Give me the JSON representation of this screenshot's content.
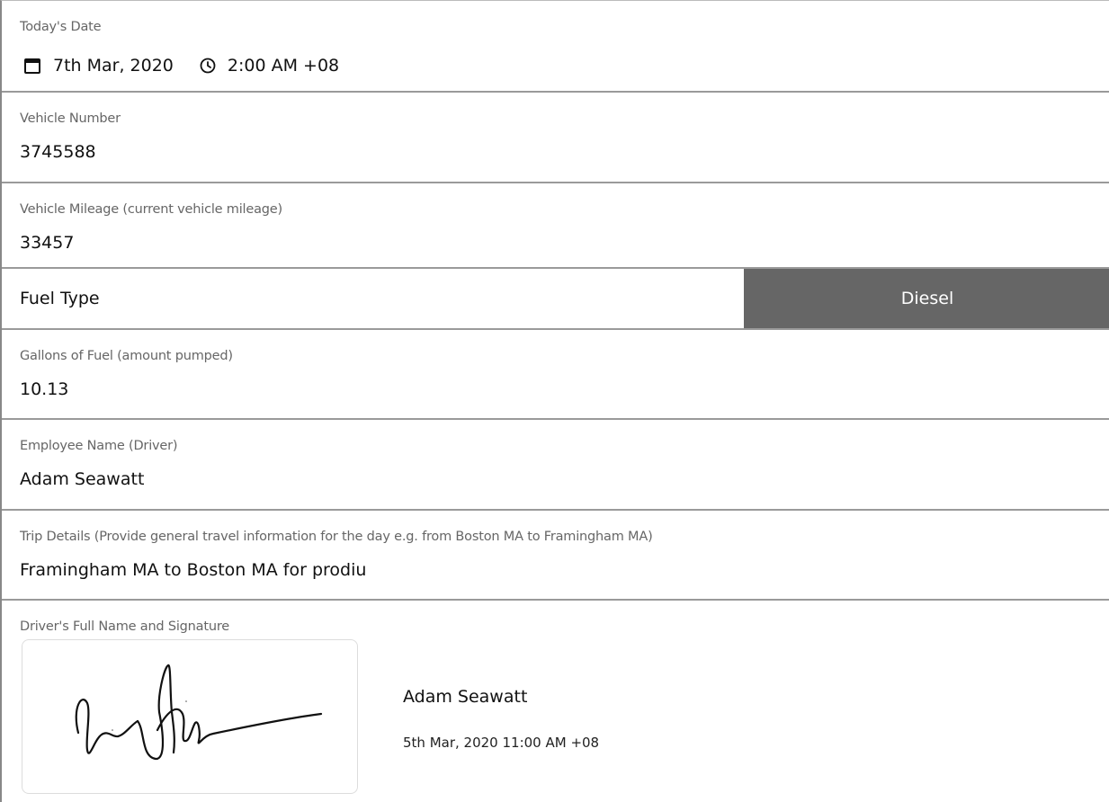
{
  "fields": {
    "date": {
      "label": "Today's Date",
      "date_value": "7th Mar, 2020",
      "time_value": "2:00 AM +08",
      "date_icon": "calendar-icon",
      "time_icon": "clock-icon"
    },
    "vehicle_number": {
      "label": "Vehicle Number",
      "value": "3745588"
    },
    "vehicle_mileage": {
      "label": "Vehicle Mileage (current vehicle mileage)",
      "value": "33457"
    },
    "fuel_type": {
      "label": "Fuel Type",
      "value": "Diesel"
    },
    "gallons": {
      "label": "Gallons of Fuel (amount pumped)",
      "value": "10.13"
    },
    "employee": {
      "label": "Employee Name (Driver)",
      "value": "Adam Seawatt"
    },
    "trip": {
      "label": "Trip Details (Provide general travel information for the day e.g. from Boston MA to Framingham MA)",
      "value": "Framingham MA to Boston MA for prodiu"
    },
    "signature": {
      "label": "Driver's Full Name and Signature",
      "name": "Adam Seawatt",
      "timestamp": "5th Mar, 2020 11:00 AM +08"
    }
  },
  "colors": {
    "selected_option_bg": "#666666",
    "divider": "#9a9a9a",
    "label_text": "#666666"
  }
}
